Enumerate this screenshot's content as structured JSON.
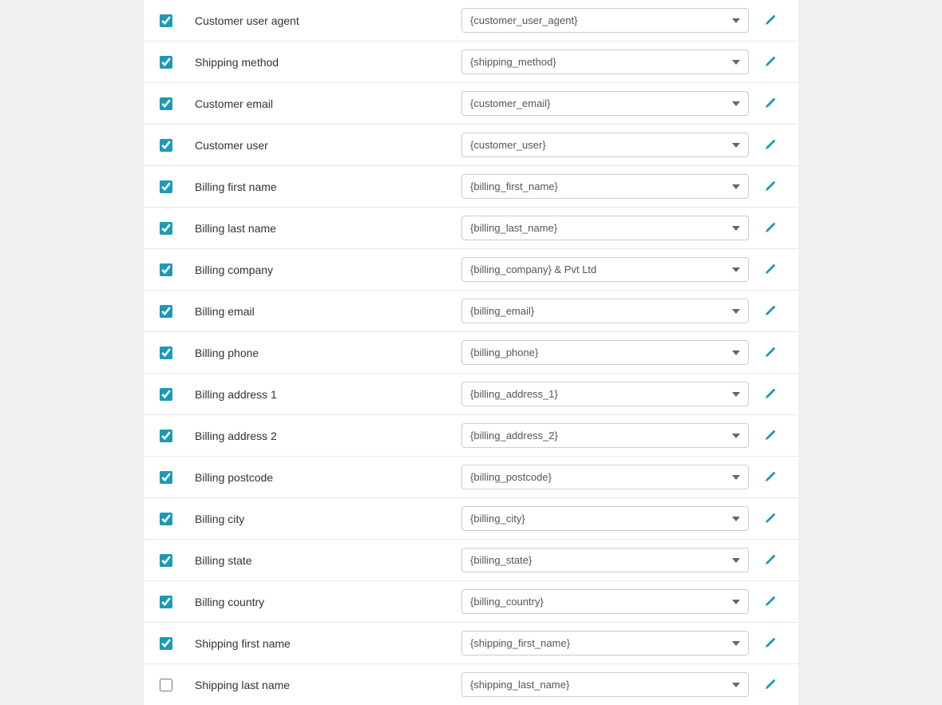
{
  "rows": [
    {
      "id": "customer_user_agent",
      "label": "Customer user agent",
      "value": "{customer_user_agent}",
      "checked": true
    },
    {
      "id": "shipping_method",
      "label": "Shipping method",
      "value": "{shipping_method}",
      "checked": true
    },
    {
      "id": "customer_email",
      "label": "Customer email",
      "value": "{customer_email}",
      "checked": true
    },
    {
      "id": "customer_user",
      "label": "Customer user",
      "value": "{customer_user}",
      "checked": true
    },
    {
      "id": "billing_first_name",
      "label": "Billing first name",
      "value": "{billing_first_name}",
      "checked": true
    },
    {
      "id": "billing_last_name",
      "label": "Billing last name",
      "value": "{billing_last_name}",
      "checked": true
    },
    {
      "id": "billing_company",
      "label": "Billing company",
      "value": "{billing_company} & Pvt Ltd",
      "checked": true
    },
    {
      "id": "billing_email",
      "label": "Billing email",
      "value": "{billing_email}",
      "checked": true
    },
    {
      "id": "billing_phone",
      "label": "Billing phone",
      "value": "{billing_phone}",
      "checked": true
    },
    {
      "id": "billing_address_1",
      "label": "Billing address 1",
      "value": "{billing_address_1}",
      "checked": true
    },
    {
      "id": "billing_address_2",
      "label": "Billing address 2",
      "value": "{billing_address_2}",
      "checked": true
    },
    {
      "id": "billing_postcode",
      "label": "Billing postcode",
      "value": "{billing_postcode}",
      "checked": true
    },
    {
      "id": "billing_city",
      "label": "Billing city",
      "value": "{billing_city}",
      "checked": true
    },
    {
      "id": "billing_state",
      "label": "Billing state",
      "value": "{billing_state}",
      "checked": true
    },
    {
      "id": "billing_country",
      "label": "Billing country",
      "value": "{billing_country}",
      "checked": true
    },
    {
      "id": "shipping_first_name",
      "label": "Shipping first name",
      "value": "{shipping_first_name}",
      "checked": true
    },
    {
      "id": "shipping_last_name",
      "label": "Shipping last name",
      "value": "{shipping_last_name}",
      "checked": false
    }
  ],
  "icons": {
    "edit": "pencil-icon"
  }
}
